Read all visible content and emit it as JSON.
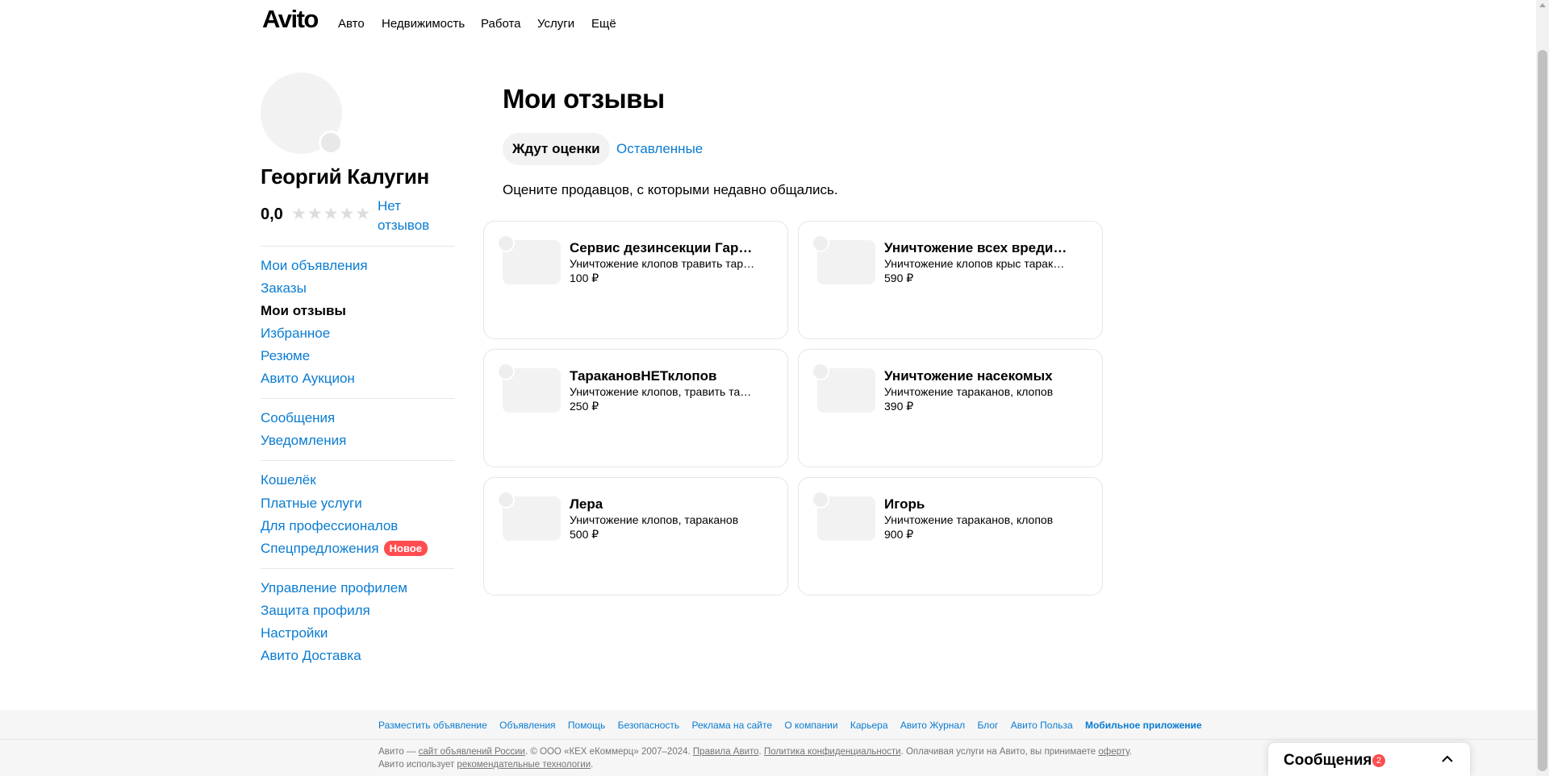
{
  "header": {
    "logo": "Avito",
    "nav": [
      {
        "label": "Авто"
      },
      {
        "label": "Недвижимость"
      },
      {
        "label": "Работа"
      },
      {
        "label": "Услуги"
      },
      {
        "label": "Ещё"
      }
    ]
  },
  "profile": {
    "name": "Георгий Калугин",
    "rating": "0,0",
    "stars": "★★★★★",
    "no_reviews": "Нет отзывов"
  },
  "sidebar": {
    "groups": [
      [
        {
          "label": "Мои объявления"
        },
        {
          "label": "Заказы"
        },
        {
          "label": "Мои отзывы",
          "active": true
        },
        {
          "label": "Избранное"
        },
        {
          "label": "Резюме"
        },
        {
          "label": "Авито Аукцион"
        }
      ],
      [
        {
          "label": "Сообщения"
        },
        {
          "label": "Уведомления"
        }
      ],
      [
        {
          "label": "Кошелёк"
        },
        {
          "label": "Платные услуги"
        },
        {
          "label": "Для профессионалов"
        },
        {
          "label": "Спецпредложения",
          "badge": "Новое"
        }
      ],
      [
        {
          "label": "Управление профилем"
        },
        {
          "label": "Защита профиля"
        },
        {
          "label": "Настройки"
        },
        {
          "label": "Авито Доставка"
        }
      ]
    ]
  },
  "main": {
    "title": "Мои отзывы",
    "tabs": [
      {
        "label": "Ждут оценки",
        "active": true
      },
      {
        "label": "Оставленные",
        "active": false
      }
    ],
    "hint": "Оцените продавцов, с которыми недавно общались.",
    "cards": [
      {
        "title": "Сервис дезинсекции Гараж",
        "subtitle": "Уничтожение клопов травить тараканов",
        "price": "100 ₽"
      },
      {
        "title": "Уничтожение всех вредителей",
        "subtitle": "Уничтожение клопов крыс тараканов",
        "price": "590 ₽"
      },
      {
        "title": "ТаракановНЕТклопов",
        "subtitle": "Уничтожение клопов, травить тараканов",
        "price": "250 ₽"
      },
      {
        "title": "Уничтожение насекомых",
        "subtitle": "Уничтожение тараканов, клопов",
        "price": "390 ₽"
      },
      {
        "title": "Лера",
        "subtitle": "Уничтожение клопов, тараканов",
        "price": "500 ₽"
      },
      {
        "title": "Игорь",
        "subtitle": "Уничтожение тараканов, клопов",
        "price": "900 ₽"
      }
    ]
  },
  "footer": {
    "links": [
      {
        "label": "Разместить объявление"
      },
      {
        "label": "Объявления"
      },
      {
        "label": "Помощь"
      },
      {
        "label": "Безопасность"
      },
      {
        "label": "Реклама на сайте"
      },
      {
        "label": "О компании"
      },
      {
        "label": "Карьера"
      },
      {
        "label": "Авито Журнал"
      },
      {
        "label": "Блог"
      },
      {
        "label": "Авито Польза"
      },
      {
        "label": "Мобильное приложение",
        "strong": true
      }
    ],
    "legal": {
      "t1": "Авито — ",
      "l1": "сайт объявлений России",
      "t2": ". © ООО «КЕХ еКоммерц» 2007–2024. ",
      "l2": "Правила Авито",
      "t3": ". ",
      "l3": "Политика конфиденциальности",
      "t4": ". Оплачивая услуги на Авито, вы принимаете ",
      "l4": "оферту",
      "t5": ". Авито использует ",
      "l5": "рекомендательные технологии",
      "t6": "."
    }
  },
  "chat": {
    "title": "Сообщения",
    "count": "2"
  },
  "colors": {
    "link": "#0a7cd2",
    "badge": "#ff4d4f",
    "card_border": "#e6e6e6",
    "placeholder": "#f2f2f2"
  }
}
